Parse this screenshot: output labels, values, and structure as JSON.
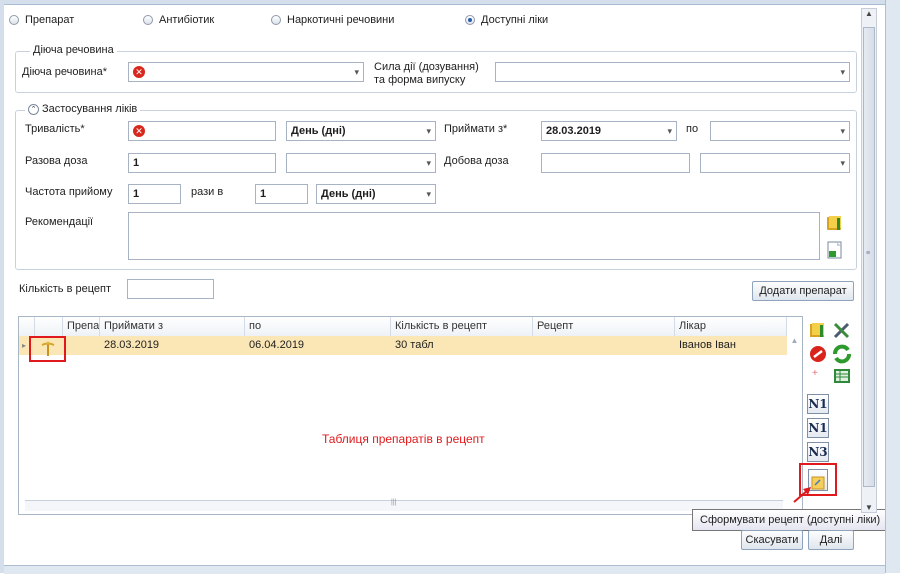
{
  "radio_options": [
    {
      "label": "Препарат",
      "checked": false
    },
    {
      "label": "Антибіотик",
      "checked": false
    },
    {
      "label": "Наркотичні речовини",
      "checked": false
    },
    {
      "label": "Доступні ліки",
      "checked": true
    }
  ],
  "substance_group": {
    "title": "Діюча речовина",
    "substance_label": "Діюча речовина*",
    "strength_label_line1": "Сила дії (дозування)",
    "strength_label_line2": "та форма випуску"
  },
  "usage_group": {
    "title": "Застосування ліків",
    "duration_label": "Тривалість*",
    "duration_unit": "День (дні)",
    "take_from_label": "Приймати з*",
    "take_from_value": "28.03.2019",
    "to_label": "по",
    "single_dose_label": "Разова доза",
    "single_dose_value": "1",
    "daily_dose_label": "Добова доза",
    "frequency_label": "Частота прийому",
    "frequency_value": "1",
    "times_per_label": "рази в",
    "period_value": "1",
    "period_unit": "День (дні)",
    "recommendations_label": "Рекомендації"
  },
  "quantity": {
    "label": "Кількість в рецепт",
    "add_button": "Додати препарат"
  },
  "table": {
    "columns": [
      "Препа",
      "Приймати з",
      "по",
      "Кількість в рецепт",
      "Рецепт",
      "Лікар"
    ],
    "rows": [
      {
        "take_from": "28.03.2019",
        "to": "06.04.2019",
        "quantity": "30 табл",
        "recipe": "",
        "doctor": "Іванов Іван"
      }
    ],
    "annotation": "Таблиця препаратів в рецепт"
  },
  "side_buttons": {
    "n1a": "N1",
    "n1b": "N1",
    "n3": "N3"
  },
  "tooltip": "Сформувати рецепт (доступні ліки)",
  "footer": {
    "cancel": "Скасувати",
    "next": "Далі"
  },
  "colors": {
    "highlight_box": "#e0191c",
    "annotation_text": "#e0191c",
    "selected_row": "#fbe7b5"
  }
}
